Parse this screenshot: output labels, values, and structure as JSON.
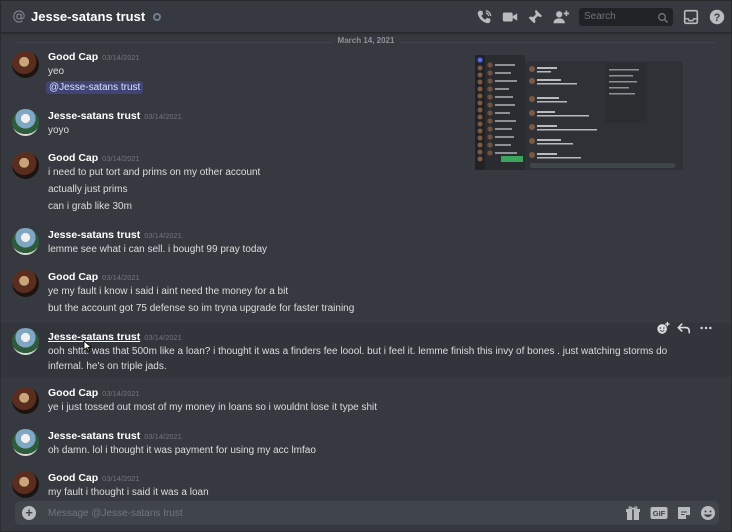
{
  "header": {
    "channel_name": "Jesse-satans trust",
    "search_placeholder": "Search"
  },
  "date_divider": "March 14, 2021",
  "messages": [
    {
      "author": "Good Cap",
      "timestamp": "03/14/2021",
      "lines": [
        "yeo"
      ],
      "mention": "@Jesse-satans trust"
    },
    {
      "author": "Jesse-satans trust",
      "timestamp": "03/14/2021",
      "lines": [
        "yoyo"
      ]
    },
    {
      "author": "Good Cap",
      "timestamp": "03/14/2021",
      "lines": [
        "i need to put tort and prims on my other account",
        "actually just prims",
        "can i grab like 30m"
      ]
    },
    {
      "author": "Jesse-satans trust",
      "timestamp": "03/14/2021",
      "lines": [
        "lemme see what i can sell. i bought 99 pray today"
      ]
    },
    {
      "author": "Good Cap",
      "timestamp": "03/14/2021",
      "lines": [
        "ye my fault i know i said i aint need the money for a bit",
        "but the account got 75 defense so im tryna upgrade for faster training"
      ]
    },
    {
      "author": "Jesse-satans trust",
      "timestamp": "03/14/2021",
      "lines": [
        "ooh shttt. was that 500m like a loan? i thought it was a finders fee loool. but i feel it. lemme finish this invy of bones . just watching storms do",
        "infernal. he's on triple jads."
      ]
    },
    {
      "author": "Good Cap",
      "timestamp": "03/14/2021",
      "lines": [
        "ye i just tossed out most of my money in loans so i wouldnt lose it type shit"
      ]
    },
    {
      "author": "Jesse-satans trust",
      "timestamp": "03/14/2021",
      "lines": [
        "oh damn. lol i thought it was payment for using my acc lmfao"
      ]
    },
    {
      "author": "Good Cap",
      "timestamp": "03/14/2021",
      "lines": [
        "my fault i thought i said it was a loan"
      ]
    }
  ],
  "input": {
    "placeholder": "Message @Jesse-satans trust"
  },
  "icons": {
    "gif_label": "GIF"
  },
  "colors": {
    "background": "#36393f",
    "header_text": "#ffffff",
    "message_text": "#dcddde",
    "timestamp": "#72767d",
    "input_bg": "#40444b"
  }
}
